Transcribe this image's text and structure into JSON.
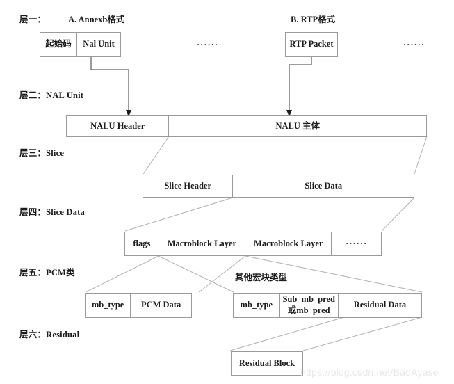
{
  "diagram": {
    "title_a": "A. Annexb格式",
    "title_b": "B. RTP格式",
    "note_other_mb": "其他宏块类型",
    "ellipsis": "······",
    "watermark": "https://blog.csdn.net/BadAyase",
    "line_color": "#9a9a9a",
    "text_color": "#1b1b1b",
    "background": "#ffffff"
  },
  "layers": [
    {
      "label": "层一："
    },
    {
      "label": "层二：NAL Unit"
    },
    {
      "label": "层三：Slice"
    },
    {
      "label": "层四：Slice Data"
    },
    {
      "label": "层五：PCM类"
    },
    {
      "label": "层六：Residual"
    }
  ],
  "boxes": {
    "annexb": {
      "cells": [
        "起始码",
        "Nal Unit"
      ]
    },
    "rtp": {
      "cells": [
        "RTP Packet"
      ]
    },
    "nal_unit": {
      "cells": [
        "NALU Header",
        "NALU 主体"
      ]
    },
    "slice": {
      "cells": [
        "Slice Header",
        "Slice Data"
      ]
    },
    "slice_data": {
      "cells": [
        "flags",
        "Macroblock Layer",
        "Macroblock Layer",
        "······"
      ]
    },
    "pcm_mb": {
      "cells": [
        "mb_type",
        "PCM Data"
      ]
    },
    "other_mb": {
      "cells": [
        "mb_type",
        "Sub_mb_pred\n或mb_pred",
        "Residual Data"
      ]
    },
    "residual": {
      "cells": [
        "Residual Block"
      ]
    }
  }
}
